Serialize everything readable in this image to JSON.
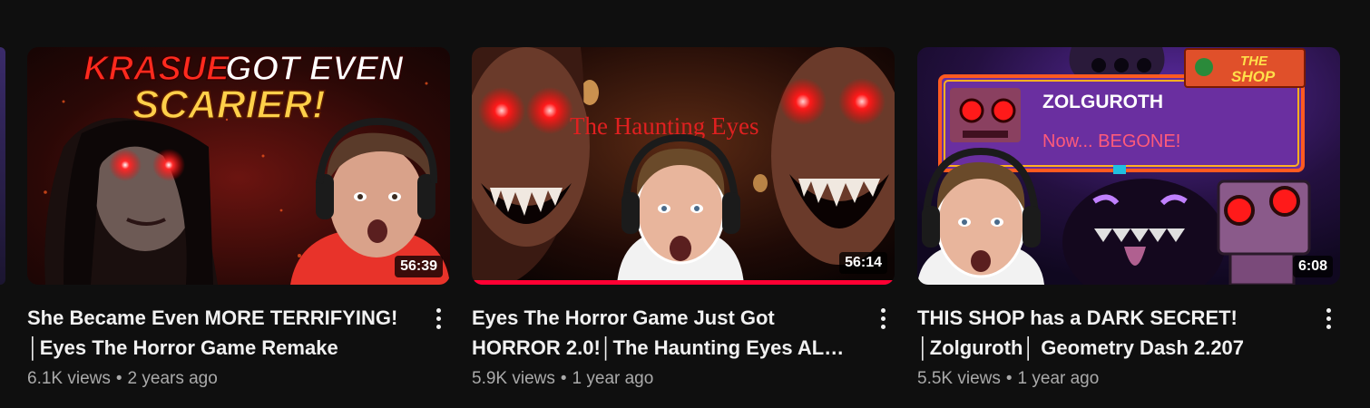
{
  "videos": [
    {
      "thumb_text": [
        "KRASUE",
        "GOT EVEN",
        "SCARIER!"
      ],
      "duration": "56:39",
      "title_lines": [
        "She Became Even MORE TERRIFYING!",
        "│Eyes The Horror Game Remake"
      ],
      "views": "6.1K views",
      "age": "2 years ago",
      "progress": null
    },
    {
      "thumb_text": [
        "The Haunting Eyes"
      ],
      "duration": "56:14",
      "title_lines": [
        "Eyes The Horror Game Just Got",
        "HORROR 2.0!│The Haunting Eyes ALL ..."
      ],
      "views": "5.9K views",
      "age": "1 year ago",
      "progress": 1.0
    },
    {
      "thumb_text": [
        "THE",
        "SHOP",
        "ZOLGUROTH",
        "Now... BEGONE!"
      ],
      "duration": "6:08",
      "title_lines": [
        "THIS SHOP has a DARK SECRET!",
        "│Zolguroth│ Geometry Dash 2.207"
      ],
      "views": "5.5K views",
      "age": "1 year ago",
      "progress": null
    }
  ],
  "separator": "•",
  "icons": {
    "more": "more-vert-icon"
  },
  "colors": {
    "background": "#0f0f0f",
    "accent": "#ff0033",
    "secondary_text": "#aaaaaa"
  }
}
